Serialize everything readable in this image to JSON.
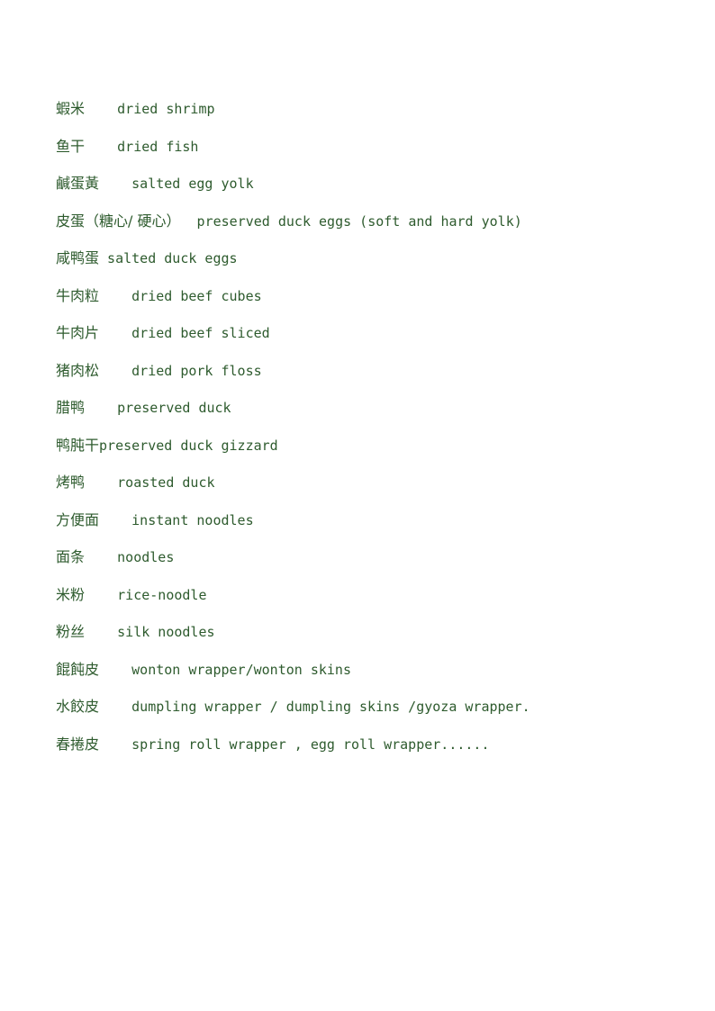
{
  "document": {
    "type": "bilingual-glossary",
    "language_pair": "Chinese-English",
    "text_color": "#2e5b2e",
    "background_color": "#ffffff"
  },
  "glossary": {
    "entries": [
      {
        "term": "蝦米",
        "gap": "    ",
        "gloss": "dried shrimp"
      },
      {
        "term": "鱼干",
        "gap": "    ",
        "gloss": "dried fish"
      },
      {
        "term": "鹹蛋黃",
        "gap": "    ",
        "gloss": "salted egg yolk"
      },
      {
        "term": "皮蛋（糖心/ 硬心）",
        "gap": "  ",
        "gloss": "preserved duck eggs (soft and hard yolk)"
      },
      {
        "term": "咸鸭蛋",
        "gap": " ",
        "gloss": "salted duck eggs"
      },
      {
        "term": "牛肉粒",
        "gap": "    ",
        "gloss": "dried beef cubes"
      },
      {
        "term": "牛肉片",
        "gap": "    ",
        "gloss": "dried beef sliced"
      },
      {
        "term": "猪肉松",
        "gap": "    ",
        "gloss": "dried pork floss"
      },
      {
        "term": "腊鸭",
        "gap": "    ",
        "gloss": "preserved duck"
      },
      {
        "term": "鸭肫干",
        "gap": "",
        "gloss": "preserved duck gizzard"
      },
      {
        "term": "烤鸭",
        "gap": "    ",
        "gloss": "roasted duck"
      },
      {
        "term": "方便面",
        "gap": "    ",
        "gloss": "instant noodles"
      },
      {
        "term": "面条",
        "gap": "    ",
        "gloss": "noodles"
      },
      {
        "term": "米粉",
        "gap": "    ",
        "gloss": "rice-noodle"
      },
      {
        "term": "粉丝",
        "gap": "    ",
        "gloss": "silk noodles"
      },
      {
        "term": "餛飩皮",
        "gap": "    ",
        "gloss": "wonton wrapper/wonton skins"
      },
      {
        "term": "水餃皮",
        "gap": "    ",
        "gloss": "dumpling wrapper / dumpling skins /gyoza wrapper."
      },
      {
        "term": "春捲皮",
        "gap": "    ",
        "gloss": "spring roll wrapper , egg roll wrapper......"
      }
    ]
  }
}
